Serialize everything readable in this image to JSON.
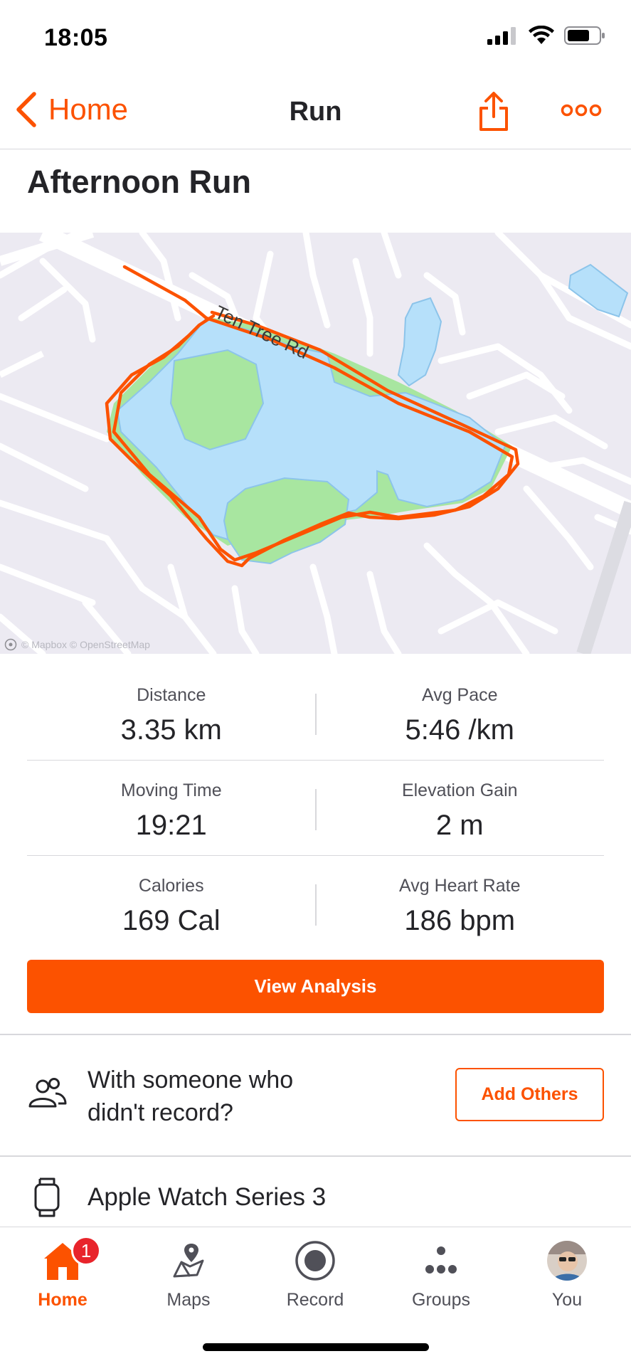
{
  "status_bar": {
    "time": "18:05"
  },
  "nav": {
    "back_label": "Home",
    "title": "Run"
  },
  "activity": {
    "title": "Afternoon Run"
  },
  "map": {
    "street_label": "Ten Tree Rd",
    "attribution": "© Mapbox © OpenStreetMap",
    "route_color": "#fc5200",
    "water_color": "#b6e0fa",
    "park_color": "#a8e6a0"
  },
  "stats": {
    "distance": {
      "label": "Distance",
      "value": "3.35 km"
    },
    "avg_pace": {
      "label": "Avg Pace",
      "value": "5:46 /km"
    },
    "moving_time": {
      "label": "Moving Time",
      "value": "19:21"
    },
    "elevation_gain": {
      "label": "Elevation Gain",
      "value": "2 m"
    },
    "calories": {
      "label": "Calories",
      "value": "169 Cal"
    },
    "avg_heart_rate": {
      "label": "Avg Heart Rate",
      "value": "186 bpm"
    }
  },
  "actions": {
    "view_analysis_label": "View Analysis",
    "add_others_label": "Add Others"
  },
  "with_others": {
    "text": "With someone who didn't record?"
  },
  "device": {
    "name": "Apple Watch Series 3"
  },
  "tabbar": {
    "items": [
      {
        "label": "Home",
        "icon": "home-icon",
        "badge": "1",
        "active": true
      },
      {
        "label": "Maps",
        "icon": "maps-icon"
      },
      {
        "label": "Record",
        "icon": "record-icon"
      },
      {
        "label": "Groups",
        "icon": "groups-icon"
      },
      {
        "label": "You",
        "icon": "avatar"
      }
    ]
  },
  "colors": {
    "accent": "#fc5200",
    "text": "#242428",
    "badge": "#e8242b"
  }
}
